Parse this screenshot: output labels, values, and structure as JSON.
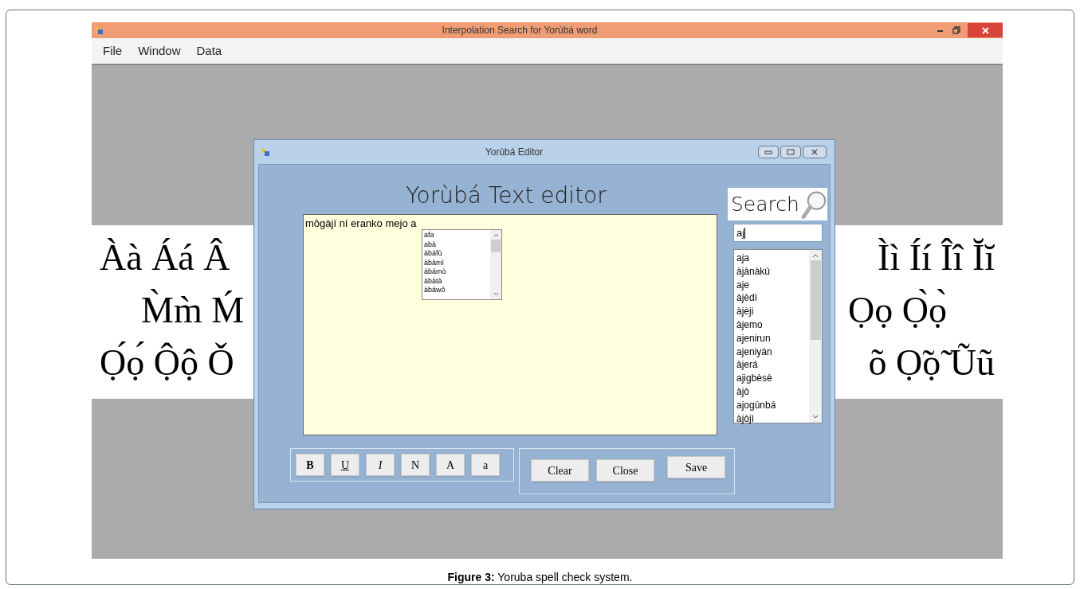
{
  "window": {
    "title": "Interpolation Search for Yorùbá  word"
  },
  "menu": [
    "File",
    "Window",
    "Data"
  ],
  "background_letters": {
    "left": [
      "Àà Áá Â",
      "M̀m̀ Ḿ",
      "Ọ́ọ́ Ộộ Ǒ"
    ],
    "right": [
      "Ìì Íí Îî Ĭĭ",
      "Ọọ Ọ̀ọ̀",
      "õ Ọ̃ọ̃ Ũũ"
    ]
  },
  "dialog": {
    "title": "Yorùbá  Editor",
    "heading": "Yorùbá  Text editor",
    "editor_text": "môgàjí ní eranko mejo a",
    "suggestions": [
      "afa",
      "abà",
      "àbáfù",
      "àbàmì",
      "àbámò",
      "àbàtà",
      "àbáwô"
    ],
    "search_label": "Search",
    "search_value": "aj",
    "results": [
      "aja",
      "àjànàkú",
      "aje",
      "àjèdì",
      "àjèji",
      "àjemo",
      "ajenirun",
      "ajeniyán",
      "àjerá",
      "ajigbèsè",
      "àjò",
      "ajogúnbá",
      "àjòjì"
    ],
    "format_buttons": [
      {
        "label": "B",
        "kind": "bold"
      },
      {
        "label": "U",
        "kind": "underline"
      },
      {
        "label": "I",
        "kind": "italic"
      },
      {
        "label": "N",
        "kind": "normal"
      },
      {
        "label": "A",
        "kind": "upper"
      },
      {
        "label": "a",
        "kind": "lower"
      }
    ],
    "action_buttons": [
      "Clear",
      "Close",
      "Save"
    ]
  },
  "caption": "**Figure 3:** Yoruba spell check system."
}
